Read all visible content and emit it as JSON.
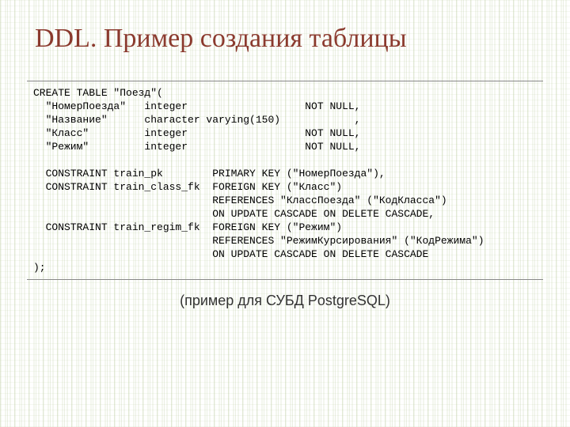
{
  "title": "DDL. Пример создания таблицы",
  "caption": "(пример для СУБД PostgreSQL)",
  "code": {
    "l01": "CREATE TABLE \"Поезд\"(",
    "l02": "  \"НомерПоезда\"   integer                   NOT NULL,",
    "l03": "  \"Название\"      character varying(150)            ,",
    "l04": "  \"Класс\"         integer                   NOT NULL,",
    "l05": "  \"Режим\"         integer                   NOT NULL,",
    "l06": "",
    "l07": "  CONSTRAINT train_pk        PRIMARY KEY (\"НомерПоезда\"),",
    "l08": "  CONSTRAINT train_class_fk  FOREIGN KEY (\"Класс\")",
    "l09": "                             REFERENCES \"КлассПоезда\" (\"КодКласса\")",
    "l10": "                             ON UPDATE CASCADE ON DELETE CASCADE,",
    "l11": "  CONSTRAINT train_regim_fk  FOREIGN KEY (\"Режим\")",
    "l12": "                             REFERENCES \"РежимКурсирования\" (\"КодРежима\")",
    "l13": "                             ON UPDATE CASCADE ON DELETE CASCADE",
    "l14": ");"
  }
}
